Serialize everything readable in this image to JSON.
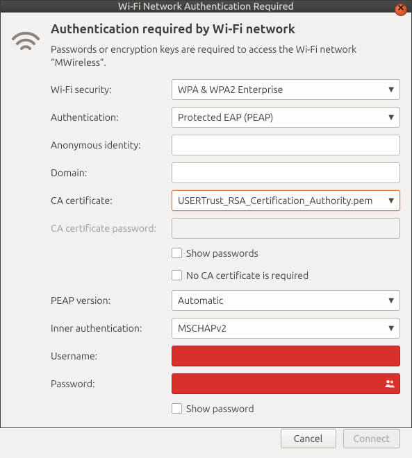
{
  "window": {
    "title": "Wi-Fi Network Authentication Required"
  },
  "header": {
    "heading": "Authentication required by Wi-Fi network",
    "description": "Passwords or encryption keys are required to access the Wi-Fi network “MWireless”."
  },
  "labels": {
    "wifi_security": "Wi-Fi security:",
    "authentication": "Authentication:",
    "anonymous_identity": "Anonymous identity:",
    "domain": "Domain:",
    "ca_certificate": "CA certificate:",
    "ca_cert_password": "CA certificate password:",
    "show_passwords": "Show passwords",
    "no_ca_required": "No CA certificate is required",
    "peap_version": "PEAP version:",
    "inner_auth": "Inner authentication:",
    "username": "Username:",
    "password": "Password:",
    "show_password": "Show password"
  },
  "values": {
    "wifi_security": "WPA & WPA2 Enterprise",
    "authentication": "Protected EAP (PEAP)",
    "anonymous_identity": "",
    "domain": "",
    "ca_certificate": "USERTrust_RSA_Certification_Authority.pem",
    "ca_cert_password": "",
    "peap_version": "Automatic",
    "inner_auth": "MSCHAPv2",
    "username": "",
    "password": "",
    "show_passwords_checked": false,
    "no_ca_required_checked": false,
    "show_password_checked": false
  },
  "actions": {
    "cancel": "Cancel",
    "connect": "Connect"
  },
  "colors": {
    "accent": "#e07746",
    "error_bg": "#d9302c"
  }
}
